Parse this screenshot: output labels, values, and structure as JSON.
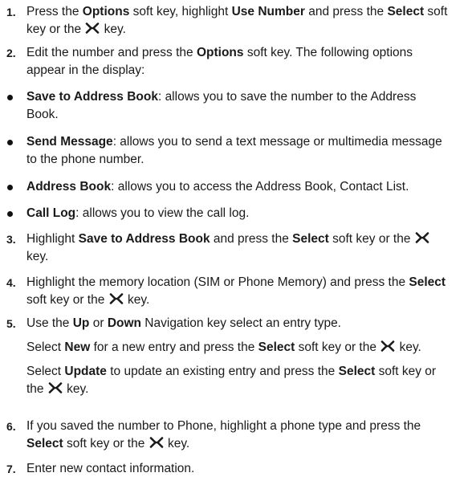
{
  "steps": {
    "s1": {
      "num": "1.",
      "l1a": "Press the ",
      "l1b": "Options",
      "l1c": " soft key, highlight ",
      "l1d": "Use Number",
      "l1e": " and press the ",
      "l1f": "Select",
      "l1g": " soft",
      "l2a": "key or the ",
      "l2b": " key."
    },
    "s2": {
      "num": "2.",
      "l1a": "Edit the number and press the ",
      "l1b": "Options",
      "l1c": " soft key. The following options",
      "l2a": "appear in the display:"
    },
    "b1": {
      "l1a": "Save to Address Book",
      "l1b": ": allows you to save the number to the Address",
      "l2a": "Book."
    },
    "b2": {
      "l1a": "Send Message",
      "l1b": ": allows you to send a text message or multimedia message",
      "l2a": "to the phone number."
    },
    "b3": {
      "l1a": "Address Book",
      "l1b": ": allows you to access the Address Book, Contact List."
    },
    "b4": {
      "l1a": "Call Log",
      "l1b": ": allows you to view the call log."
    },
    "s3": {
      "num": "3.",
      "l1a": "Highlight ",
      "l1b": "Save to Address Book",
      "l1c": " and press the ",
      "l1d": "Select",
      "l1e": " soft key or the ",
      "l2a": "key."
    },
    "s4": {
      "num": "4.",
      "l1a": "Highlight the memory location (SIM or Phone Memory) and press the ",
      "l1b": "Select",
      "l2a": "soft key or the ",
      "l2b": " key."
    },
    "s5": {
      "num": "5.",
      "l1a": "Use the ",
      "l1b": "Up",
      "l1c": " or ",
      "l1d": "Down",
      "l1e": " Navigation key select an entry type.",
      "p2a": "Select ",
      "p2b": "New",
      "p2c": " for a new entry and press the ",
      "p2d": "Select",
      "p2e": " soft key or the ",
      "p2f": " key.",
      "p3a": "Select ",
      "p3b": "Update",
      "p3c": " to update an existing entry and press the ",
      "p3d": "Select",
      "p3e": " soft key or",
      "p3f": "the ",
      "p3g": " key."
    },
    "s6": {
      "num": "6.",
      "l1a": "If you saved the number to Phone, highlight a phone type and press the",
      "l2a": "Select",
      "l2b": " soft key or the ",
      "l2c": " key."
    },
    "s7": {
      "num": "7.",
      "l1a": "Enter new contact information."
    }
  },
  "icons": {
    "key": "ok-key-icon"
  }
}
